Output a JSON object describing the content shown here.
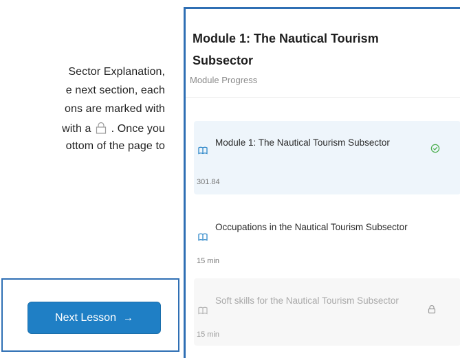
{
  "document": {
    "lines": [
      "Sector Explanation,",
      "e next section, each",
      "ons are marked with",
      "with a",
      ". Once you",
      "ottom of the page to"
    ]
  },
  "next_button": {
    "label": "Next Lesson",
    "arrow": "→"
  },
  "panel": {
    "title": "Module 1: The Nautical Tourism Subsector",
    "subtitle": "Module Progress",
    "lessons": [
      {
        "title": "Module 1: The Nautical Tourism Subsector",
        "meta": "301.84",
        "state": "completed"
      },
      {
        "title": "Occupations in the Nautical Tourism Subsector",
        "meta": "15 min",
        "state": "available"
      },
      {
        "title": "Soft skills for the Nautical Tourism Subsector",
        "meta": "15 min",
        "state": "locked"
      }
    ]
  },
  "colors": {
    "accent": "#1f7fc5",
    "frame": "#2f6fb4",
    "complete": "#4caf50",
    "active_bg": "#eef5fb"
  },
  "icons": [
    "lock-icon",
    "book-open-icon",
    "check-circle-icon",
    "arrow-right-icon"
  ]
}
